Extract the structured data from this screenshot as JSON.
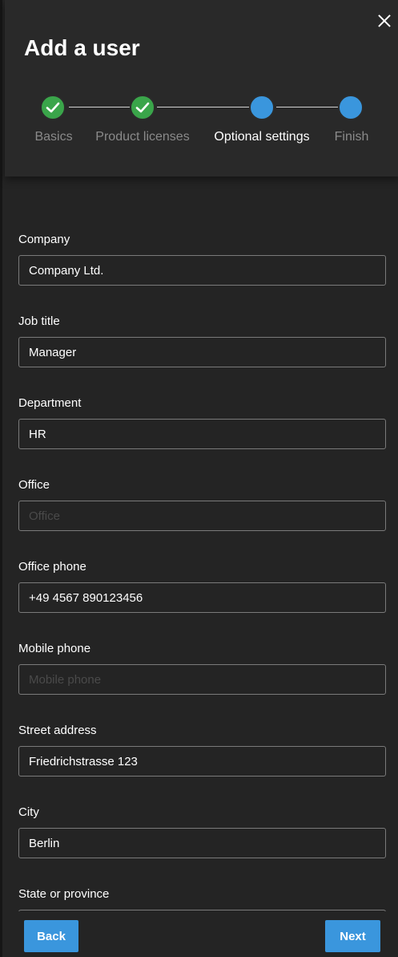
{
  "dialog": {
    "title": "Add a user",
    "close_icon": "close-icon"
  },
  "stepper": {
    "steps": [
      {
        "label": "Basics",
        "status": "complete",
        "icon": "checkmark-icon"
      },
      {
        "label": "Product licenses",
        "status": "complete",
        "icon": "checkmark-icon"
      },
      {
        "label": "Optional settings",
        "status": "current",
        "icon": "circle-icon"
      },
      {
        "label": "Finish",
        "status": "upcoming",
        "icon": "circle-icon"
      }
    ],
    "complete_color": "#3aa54a",
    "current_color": "#3a96dd"
  },
  "form": {
    "fields": [
      {
        "label": "Company",
        "value": "Company Ltd.",
        "placeholder": ""
      },
      {
        "label": "Job title",
        "value": "Manager",
        "placeholder": ""
      },
      {
        "label": "Department",
        "value": "HR",
        "placeholder": ""
      },
      {
        "label": "Office",
        "value": "",
        "placeholder": "Office"
      },
      {
        "label": "Office phone",
        "value": "+49 4567 890123456",
        "placeholder": ""
      },
      {
        "label": "Mobile phone",
        "value": "",
        "placeholder": "Mobile phone"
      },
      {
        "label": "Street address",
        "value": "Friedrichstrasse 123",
        "placeholder": ""
      },
      {
        "label": "City",
        "value": "Berlin",
        "placeholder": ""
      },
      {
        "label": "State or province",
        "value": "",
        "placeholder": ""
      }
    ]
  },
  "footer": {
    "back_label": "Back",
    "next_label": "Next",
    "accent_color": "#3a96dd"
  }
}
